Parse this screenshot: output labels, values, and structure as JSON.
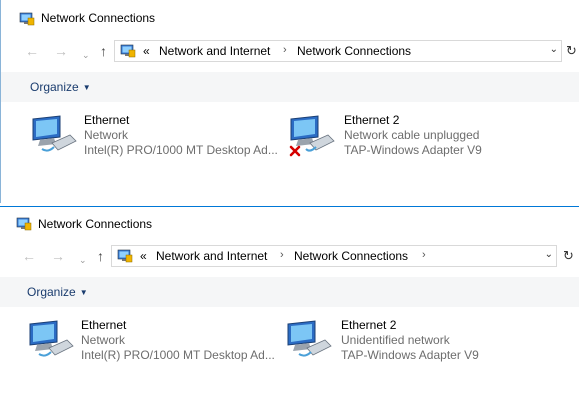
{
  "windows": [
    {
      "title": "Network Connections",
      "breadcrumbs": [
        "Network and Internet",
        "Network Connections"
      ],
      "overflow_chevron": "«",
      "trailing_arrow": "",
      "toolbar": {
        "organize_label": "Organize"
      },
      "items": [
        {
          "name": "Ethernet",
          "status": "Network",
          "adapter": "Intel(R) PRO/1000 MT Desktop Ad...",
          "icon": "network-adapter-icon",
          "disconnected": false
        },
        {
          "name": "Ethernet 2",
          "status": "Network cable unplugged",
          "adapter": "TAP-Windows Adapter V9",
          "icon": "network-adapter-icon",
          "disconnected": true
        }
      ]
    },
    {
      "title": "Network Connections",
      "breadcrumbs": [
        "Network and Internet",
        "Network Connections"
      ],
      "overflow_chevron": "«",
      "trailing_arrow": "›",
      "toolbar": {
        "organize_label": "Organize"
      },
      "items": [
        {
          "name": "Ethernet",
          "status": "Network",
          "adapter": "Intel(R) PRO/1000 MT Desktop Ad...",
          "icon": "network-adapter-icon",
          "disconnected": false
        },
        {
          "name": "Ethernet 2",
          "status": "Unidentified network",
          "adapter": "TAP-Windows Adapter V9",
          "icon": "network-adapter-icon",
          "disconnected": false
        }
      ]
    }
  ],
  "nav": {
    "back": "←",
    "forward": "→",
    "recent": "⌄",
    "up": "↑",
    "refresh": "↻",
    "address_dropdown": "⌄",
    "separator": "›"
  },
  "colors": {
    "accent": "#0078d7",
    "organize_text": "#1a3c6e",
    "status_grey": "#6d6d6d",
    "toolbar_bg": "#f5f6f7"
  }
}
